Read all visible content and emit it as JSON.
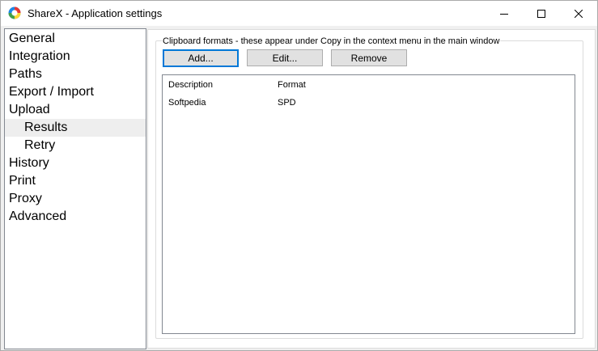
{
  "window": {
    "title": "ShareX - Application settings",
    "minimize_icon": "minimize-icon",
    "maximize_icon": "maximize-icon",
    "close_icon": "close-icon"
  },
  "sidebar": {
    "items": [
      {
        "label": "General",
        "sub": false,
        "selected": false
      },
      {
        "label": "Integration",
        "sub": false,
        "selected": false
      },
      {
        "label": "Paths",
        "sub": false,
        "selected": false
      },
      {
        "label": "Export / Import",
        "sub": false,
        "selected": false
      },
      {
        "label": "Upload",
        "sub": false,
        "selected": false
      },
      {
        "label": "Results",
        "sub": true,
        "selected": true
      },
      {
        "label": "Retry",
        "sub": true,
        "selected": false
      },
      {
        "label": "History",
        "sub": false,
        "selected": false
      },
      {
        "label": "Print",
        "sub": false,
        "selected": false
      },
      {
        "label": "Proxy",
        "sub": false,
        "selected": false
      },
      {
        "label": "Advanced",
        "sub": false,
        "selected": false
      }
    ]
  },
  "clipboard": {
    "group_label": "Clipboard formats - these appear under Copy in the context menu in the main window",
    "add_label": "Add...",
    "edit_label": "Edit...",
    "remove_label": "Remove",
    "columns": [
      "Description",
      "Format"
    ],
    "rows": [
      {
        "description": "Softpedia",
        "format": "SPD"
      }
    ]
  },
  "colors": {
    "accent": "#0078d7",
    "selection": "#eeeeee"
  }
}
